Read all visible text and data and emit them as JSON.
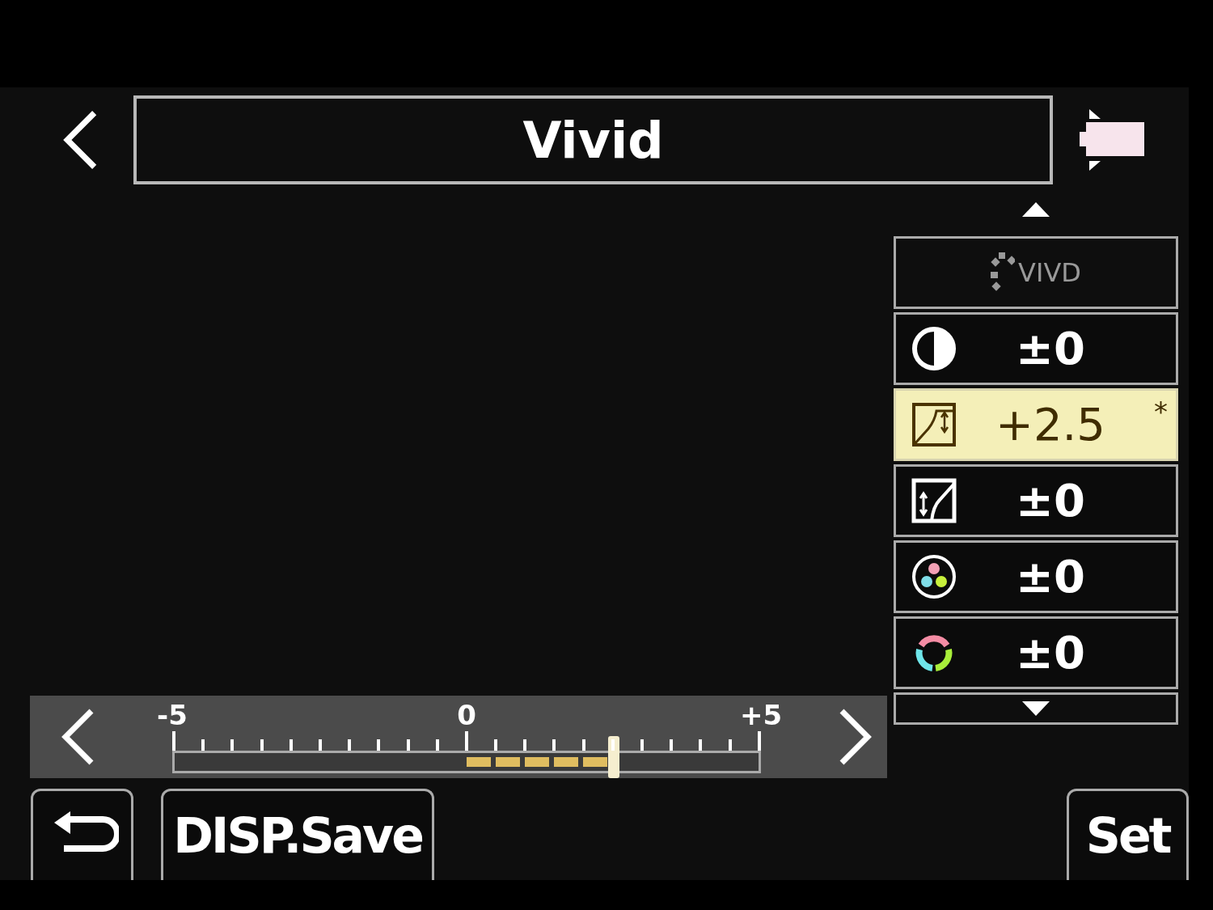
{
  "title": "Vivid",
  "style_badge": "VIVD",
  "settings": [
    {
      "kind": "contrast",
      "value": "±0",
      "selected": false
    },
    {
      "kind": "highlight",
      "value": "+2.5",
      "selected": true,
      "mark": "*"
    },
    {
      "kind": "shadow",
      "value": "±0",
      "selected": false
    },
    {
      "kind": "saturation",
      "value": "±0",
      "selected": false
    },
    {
      "kind": "hue",
      "value": "±0",
      "selected": false
    }
  ],
  "scale": {
    "labels": [
      "-5",
      "0",
      "+5"
    ],
    "level": 0.75
  },
  "buttons": [
    {
      "kind": "back"
    },
    {
      "kind": "text",
      "label": "DISP.Save"
    },
    {
      "kind": "text",
      "label": "Set"
    }
  ]
}
